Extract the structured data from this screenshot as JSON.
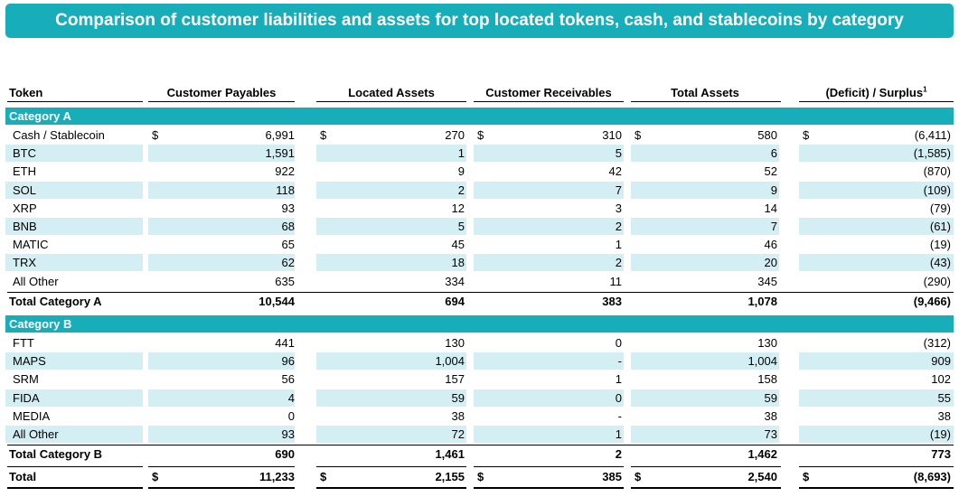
{
  "title": "Comparison of customer liabilities and assets for top located tokens, cash, and stablecoins by category",
  "headers": {
    "token": "Token",
    "customer_payables": "Customer Payables",
    "located_assets": "Located Assets",
    "customer_receivables": "Customer Receivables",
    "total_assets": "Total Assets",
    "deficit_surplus": "(Deficit) / Surplus",
    "deficit_surplus_note": "1"
  },
  "currency": "$",
  "category_a": {
    "label": "Category A",
    "rows": [
      {
        "token": "Cash / Stablecoin",
        "payables": "6,991",
        "located": "270",
        "receivables": "310",
        "total": "580",
        "surplus": "(6,411)"
      },
      {
        "token": "BTC",
        "payables": "1,591",
        "located": "1",
        "receivables": "5",
        "total": "6",
        "surplus": "(1,585)"
      },
      {
        "token": "ETH",
        "payables": "922",
        "located": "9",
        "receivables": "42",
        "total": "52",
        "surplus": "(870)"
      },
      {
        "token": "SOL",
        "payables": "118",
        "located": "2",
        "receivables": "7",
        "total": "9",
        "surplus": "(109)"
      },
      {
        "token": "XRP",
        "payables": "93",
        "located": "12",
        "receivables": "3",
        "total": "14",
        "surplus": "(79)"
      },
      {
        "token": "BNB",
        "payables": "68",
        "located": "5",
        "receivables": "2",
        "total": "7",
        "surplus": "(61)"
      },
      {
        "token": "MATIC",
        "payables": "65",
        "located": "45",
        "receivables": "1",
        "total": "46",
        "surplus": "(19)"
      },
      {
        "token": "TRX",
        "payables": "62",
        "located": "18",
        "receivables": "2",
        "total": "20",
        "surplus": "(43)"
      },
      {
        "token": "All Other",
        "payables": "635",
        "located": "334",
        "receivables": "11",
        "total": "345",
        "surplus": "(290)"
      }
    ],
    "total": {
      "token": "Total Category A",
      "payables": "10,544",
      "located": "694",
      "receivables": "383",
      "total": "1,078",
      "surplus": "(9,466)"
    }
  },
  "category_b": {
    "label": "Category B",
    "rows": [
      {
        "token": "FTT",
        "payables": "441",
        "located": "130",
        "receivables": "0",
        "total": "130",
        "surplus": "(312)"
      },
      {
        "token": "MAPS",
        "payables": "96",
        "located": "1,004",
        "receivables": "-",
        "total": "1,004",
        "surplus": "909"
      },
      {
        "token": "SRM",
        "payables": "56",
        "located": "157",
        "receivables": "1",
        "total": "158",
        "surplus": "102"
      },
      {
        "token": "FIDA",
        "payables": "4",
        "located": "59",
        "receivables": "0",
        "total": "59",
        "surplus": "55"
      },
      {
        "token": "MEDIA",
        "payables": "0",
        "located": "38",
        "receivables": "-",
        "total": "38",
        "surplus": "38"
      },
      {
        "token": "All Other",
        "payables": "93",
        "located": "72",
        "receivables": "1",
        "total": "73",
        "surplus": "(19)"
      }
    ],
    "total": {
      "token": "Total Category B",
      "payables": "690",
      "located": "1,461",
      "receivables": "2",
      "total": "1,462",
      "surplus": "773"
    }
  },
  "grand_total": {
    "token": "Total",
    "payables": "11,233",
    "located": "2,155",
    "receivables": "385",
    "total": "2,540",
    "surplus": "(8,693)"
  },
  "colors": {
    "accent": "#17aeb9",
    "band": "#d3eff3"
  }
}
